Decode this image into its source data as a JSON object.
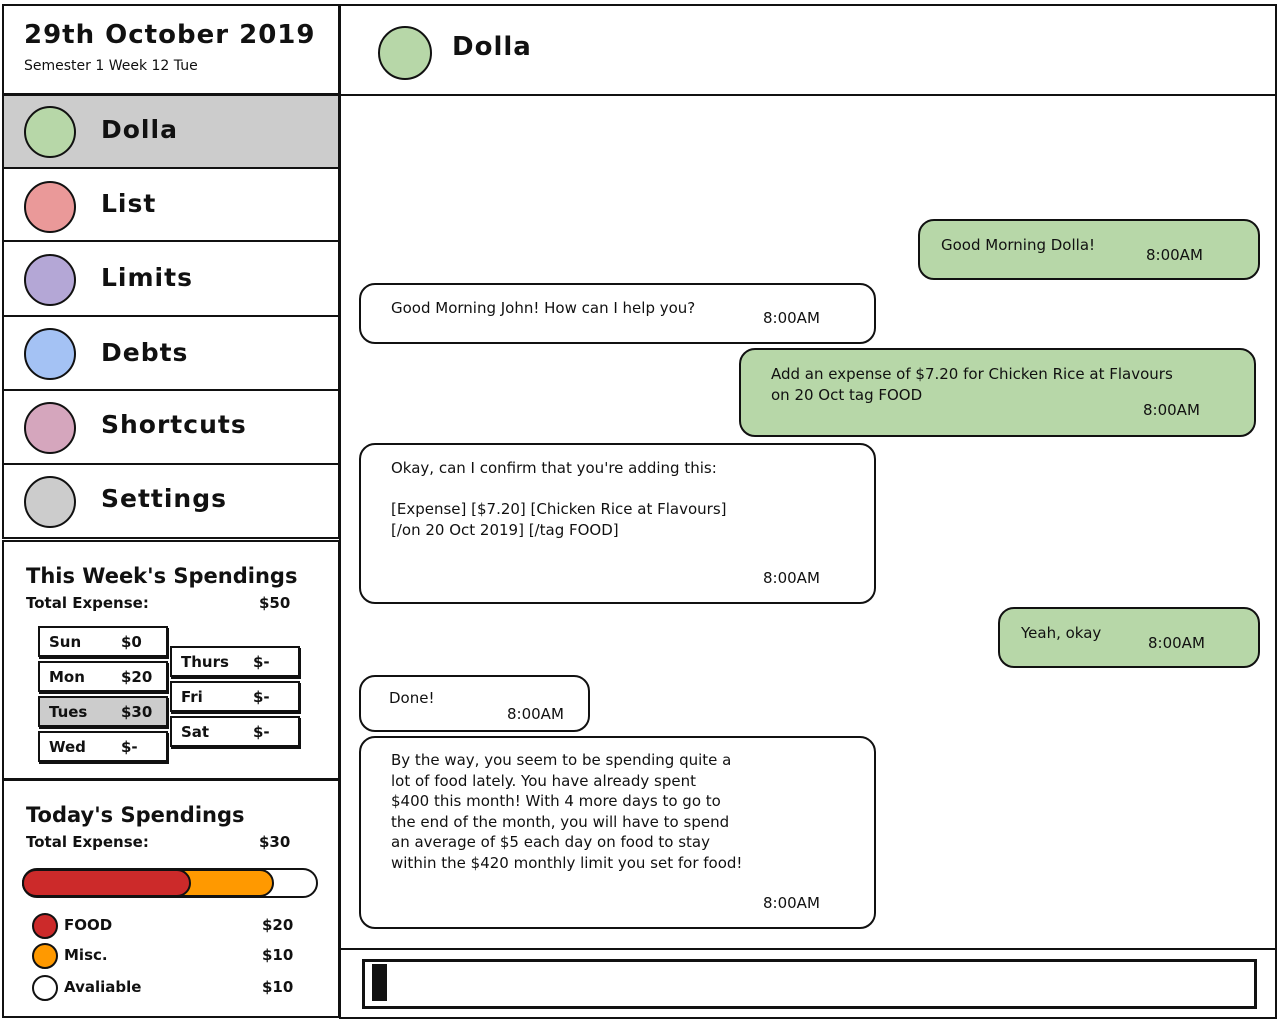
{
  "sidebar": {
    "date_title": "29th October 2019",
    "date_sub": "Semester 1 Week 12 Tue",
    "nav": [
      {
        "label": "Dolla",
        "color": "#b7d7a8",
        "active": true
      },
      {
        "label": "List",
        "color": "#ea9999",
        "active": false
      },
      {
        "label": "Limits",
        "color": "#b4a7d6",
        "active": false
      },
      {
        "label": "Debts",
        "color": "#a4c2f4",
        "active": false
      },
      {
        "label": "Shortcuts",
        "color": "#d5a6bd",
        "active": false
      },
      {
        "label": "Settings",
        "color": "#cccccc",
        "active": false
      }
    ]
  },
  "week": {
    "title": "This Week's Spendings",
    "total_label": "Total Expense:",
    "total_value": "$50",
    "days": [
      {
        "day": "Sun",
        "amount": "$0"
      },
      {
        "day": "Mon",
        "amount": "$20"
      },
      {
        "day": "Tues",
        "amount": "$30",
        "active": true
      },
      {
        "day": "Wed",
        "amount": "$-"
      },
      {
        "day": "Thurs",
        "amount": "$-"
      },
      {
        "day": "Fri",
        "amount": "$-"
      },
      {
        "day": "Sat",
        "amount": "$-"
      }
    ]
  },
  "today": {
    "title": "Today's Spendings",
    "total_label": "Total Expense:",
    "total_value": "$30",
    "bar": {
      "food_fraction": 0.57,
      "misc_fraction": 0.28
    },
    "legend": [
      {
        "label": "FOOD",
        "amount": "$20",
        "color": "#cc2a2a"
      },
      {
        "label": "Misc.",
        "amount": "$10",
        "color": "#ff9900"
      },
      {
        "label": "Avaliable",
        "amount": "$10",
        "color": "#ffffff"
      }
    ]
  },
  "chat": {
    "name": "Dolla",
    "avatar_color": "#b7d7a8",
    "messages": [
      {
        "from": "user",
        "text": "Good Morning Dolla!",
        "time": "8:00AM"
      },
      {
        "from": "bot",
        "text": "Good Morning John! How can I help you?",
        "time": "8:00AM"
      },
      {
        "from": "user",
        "text": "Add an expense of $7.20 for Chicken Rice at Flavours\non 20 Oct tag FOOD",
        "time": "8:00AM"
      },
      {
        "from": "bot",
        "text": "Okay, can I confirm that you're adding this:\n\n[Expense] [$7.20] [Chicken Rice at Flavours]\n[/on 20 Oct 2019] [/tag FOOD]",
        "time": "8:00AM"
      },
      {
        "from": "user",
        "text": "Yeah, okay",
        "time": "8:00AM"
      },
      {
        "from": "bot",
        "text": "Done!",
        "time": "8:00AM"
      },
      {
        "from": "bot",
        "text": "By the way, you seem to be spending quite a\nlot of food lately. You have already spent\n$400 this month! With 4 more days to go to\nthe end of the month, you will have to spend\nan average of $5 each day on food to stay\nwithin the $420 monthly limit you set for food!",
        "time": "8:00AM"
      }
    ]
  },
  "composer": {
    "value": ""
  }
}
